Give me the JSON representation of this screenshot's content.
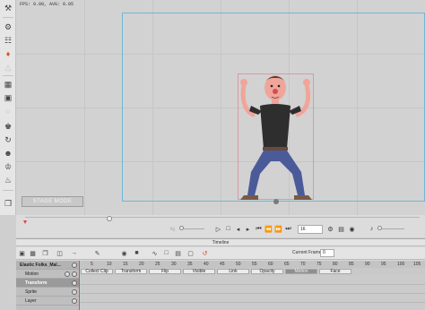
{
  "stage": {
    "fps_text": "FPS: 0.00, AVG: 0.05",
    "stage_mode_label": "STAGE MODE"
  },
  "toolbar": {
    "icons": [
      "pose-icon",
      "bone-icon",
      "layers-icon",
      "flip-icon",
      "mesh-icon",
      "film-icon",
      "image-icon",
      "puppet-icon",
      "walk-icon",
      "motion-icon",
      "spring-icon",
      "clone-icon"
    ]
  },
  "playback": {
    "frame_value": "16"
  },
  "timeline": {
    "title": "Timeline",
    "current_frame_label": "Current Frame:",
    "current_frame_value": "0",
    "ruler": [
      "5",
      "10",
      "15",
      "20",
      "25",
      "30",
      "35",
      "40",
      "45",
      "50",
      "55",
      "60",
      "65",
      "70",
      "75",
      "80",
      "85",
      "90",
      "95",
      "100",
      "105"
    ],
    "tabs": [
      {
        "label": "Collect Clip",
        "active": false
      },
      {
        "label": "Transform",
        "active": false
      },
      {
        "label": "Flip",
        "active": false
      },
      {
        "label": "Visible",
        "active": false
      },
      {
        "label": "Link",
        "active": false
      },
      {
        "label": "Opacity",
        "active": false
      },
      {
        "label": "Motion",
        "active": true
      },
      {
        "label": "Face",
        "active": false
      }
    ],
    "layers": [
      "Elastic Folks_Mal...",
      "Motion",
      "Transform",
      "Sprite",
      "Layer"
    ]
  },
  "colors": {
    "frame_border": "#6fb8d4",
    "selection_border": "#d89aa4",
    "shirt": "#2e2e2e",
    "pants": "#4b5b9a",
    "skin": "#f0a59a"
  }
}
